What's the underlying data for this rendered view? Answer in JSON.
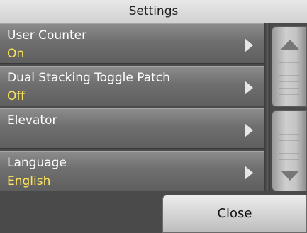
{
  "title": "Settings",
  "items": [
    {
      "label": "User Counter",
      "value": "On"
    },
    {
      "label": "Dual Stacking Toggle Patch",
      "value": "Off"
    },
    {
      "label": "Elevator",
      "value": ""
    },
    {
      "label": "Language",
      "value": "English"
    }
  ],
  "close_label": "Close",
  "icons": {
    "chevron": "chevron-right-icon",
    "scroll_up": "scroll-up-icon",
    "scroll_down": "scroll-down-icon"
  },
  "colors": {
    "value_text": "#ffe45a",
    "background": "#4a4a4a"
  }
}
